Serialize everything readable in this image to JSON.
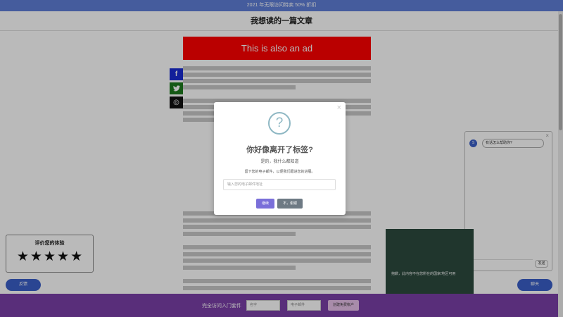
{
  "top_banner": {
    "text": "2021 年无限访问特卖 50% 折扣"
  },
  "header": {
    "title": "我想读的一篇文章"
  },
  "ad": {
    "text": "This is also an ad"
  },
  "social": {
    "facebook": "f",
    "twitter": "t",
    "instagram": "◎"
  },
  "rating": {
    "title": "评价您的体验",
    "stars": [
      "★",
      "★",
      "★",
      "★",
      "★"
    ]
  },
  "feedback_button": {
    "label": "反馈"
  },
  "chat_button": {
    "label": "聊天"
  },
  "chat": {
    "avatar": "S",
    "message": "有话怎么帮助你?",
    "send_label": "发送",
    "close": "×"
  },
  "dark_box": {
    "text": "抱歉，此内容不在您所在的国家/地区可用"
  },
  "footer": {
    "label": "完全访问入门套件",
    "name_placeholder": "名字",
    "email_placeholder": "电子邮件",
    "button_label": "创建免费帐户"
  },
  "modal": {
    "close": "×",
    "icon": "?",
    "title": "你好像离开了标签?",
    "subtitle": "是的，我什么都知道",
    "description": "留下您的电子邮件，以便我们跟进您的进展。",
    "input_placeholder": "输入您的电子邮件地址",
    "confirm_label": "继续",
    "decline_label": "不，谢谢"
  }
}
